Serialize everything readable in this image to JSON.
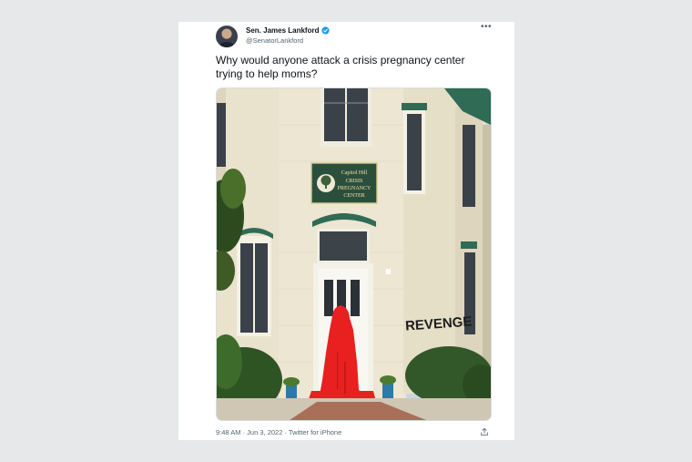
{
  "tweet": {
    "author_name": "Sen. James Lankford",
    "handle": "@SenatorLankford",
    "text": "Why would anyone attack a crisis pregnancy center trying to help moms?",
    "timestamp": "9:48 AM · Jun 3, 2022 · Twitter for iPhone",
    "more_icon": "more-horizontal-icon",
    "verified_icon": "verified-badge-icon",
    "share_icon": "share-icon"
  },
  "photo": {
    "sign_lines": [
      "Capitol Hill",
      "CRISIS",
      "PREGNANCY",
      "CENTER"
    ],
    "graffiti": "REVENGE"
  },
  "colors": {
    "verified": "#1d9bf0",
    "paint_red": "#e8201f",
    "trim_green": "#2f6b55",
    "building_cream": "#ece6d3"
  }
}
